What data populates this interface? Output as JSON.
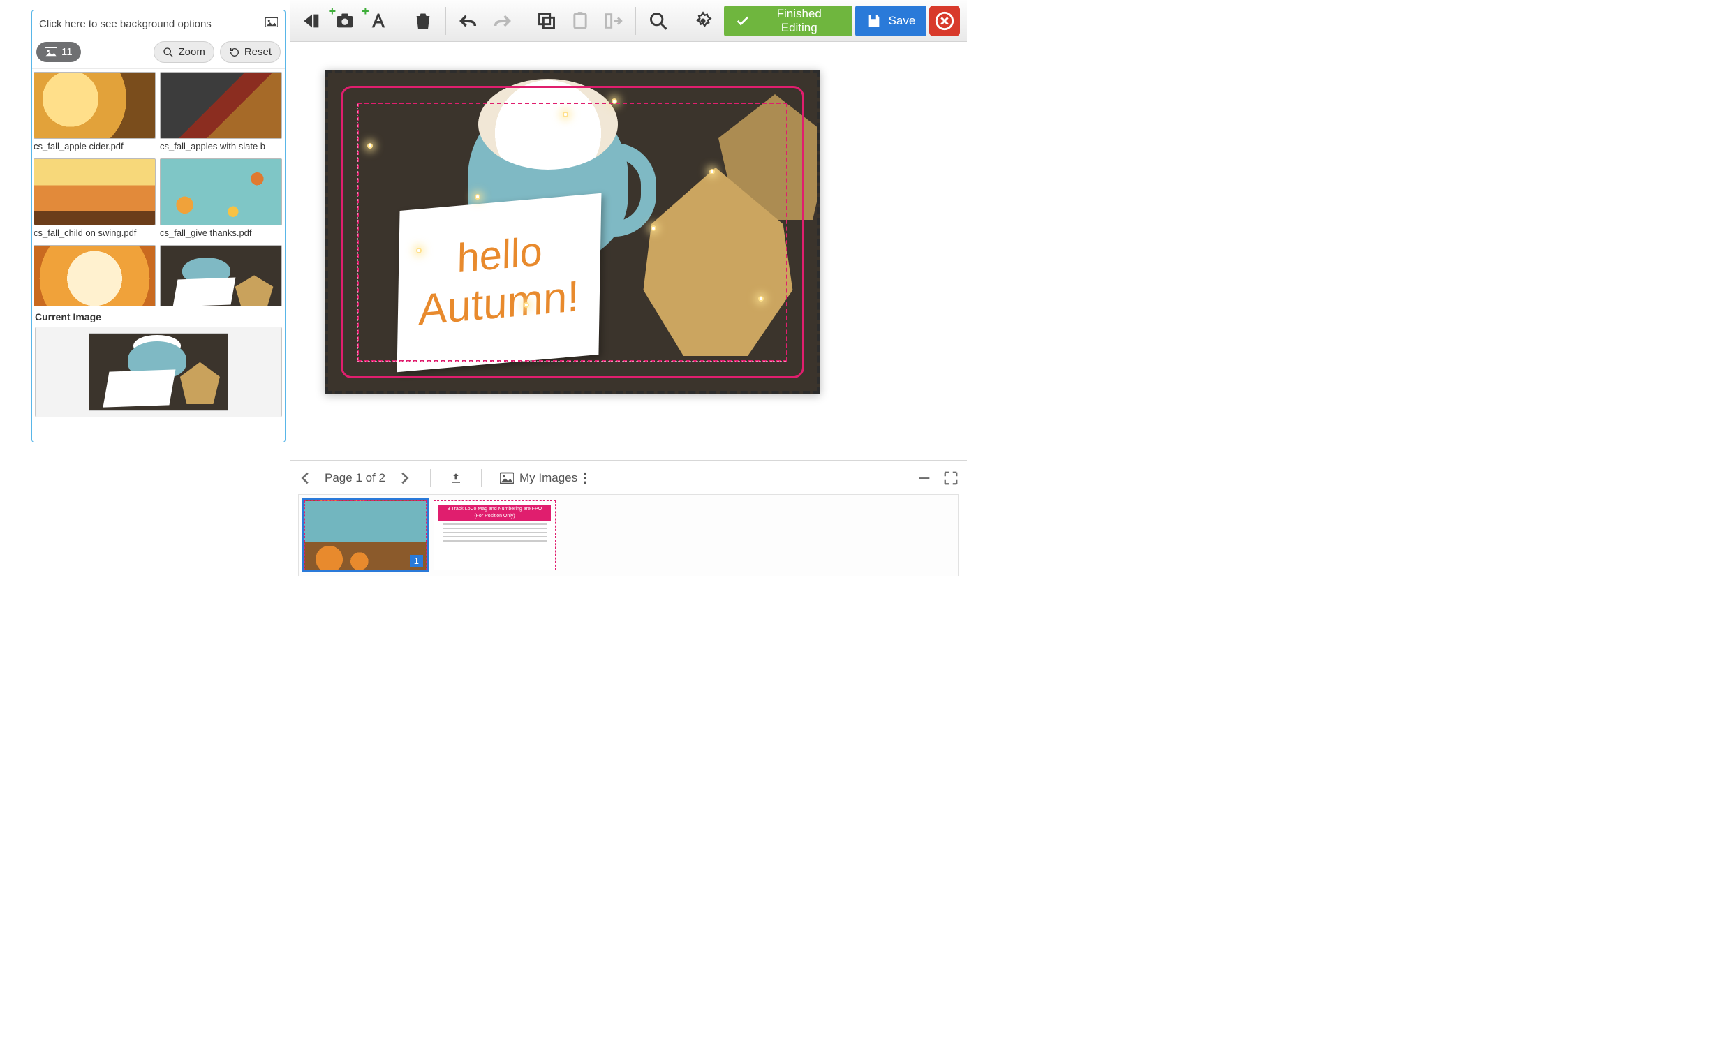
{
  "colors": {
    "accent_pink": "#e01e6e",
    "green": "#6fb63e",
    "blue": "#2a7ad9",
    "red": "#d83a2b"
  },
  "sidebar": {
    "header": "Click here to see background options",
    "count": "11",
    "zoom": "Zoom",
    "reset": "Reset",
    "current_label": "Current Image",
    "thumbs": [
      {
        "label": "cs_fall_apple cider.pdf"
      },
      {
        "label": "cs_fall_apples with slate b"
      },
      {
        "label": "cs_fall_child on swing.pdf"
      },
      {
        "label": "cs_fall_give thanks.pdf"
      },
      {
        "label": ""
      },
      {
        "label": ""
      }
    ]
  },
  "toolbar": {
    "finished": "Finished Editing",
    "save": "Save"
  },
  "canvas": {
    "card_line1": "hello",
    "card_line2": "Autumn!"
  },
  "footer": {
    "page_label": "Page 1 of 2",
    "my_images": "My Images",
    "page_badges": [
      "1"
    ],
    "page2": {
      "banner_line1": "3 Track LoCo Mag and Numbering are FPO",
      "banner_line2": "(For Position Only)"
    }
  }
}
